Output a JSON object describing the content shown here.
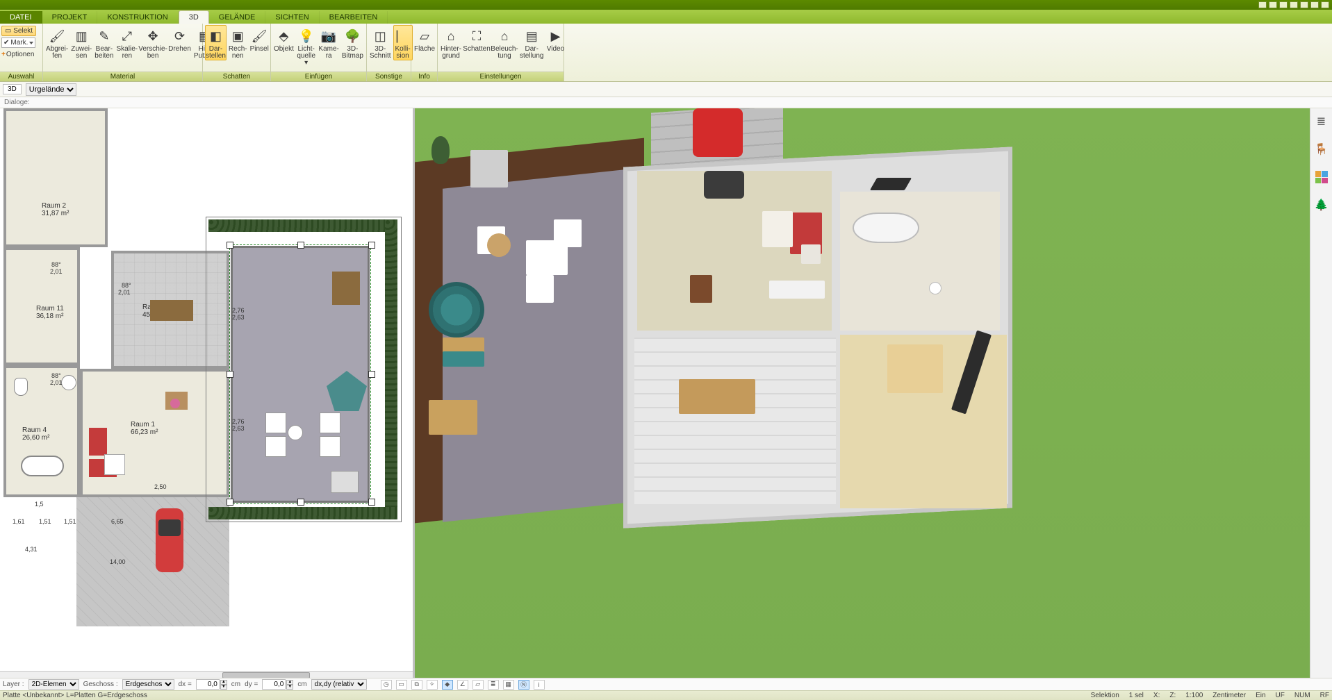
{
  "window_icons": 7,
  "menu": {
    "tabs": [
      "DATEI",
      "PROJEKT",
      "KONSTRUKTION",
      "3D",
      "GELÄNDE",
      "SICHTEN",
      "BEARBEITEN"
    ],
    "active": "3D"
  },
  "ribbon": {
    "groups": {
      "auswahl": {
        "title": "Auswahl",
        "selekt": "Selekt",
        "mark": "Mark.",
        "optionen": "Optionen"
      },
      "material": {
        "title": "Material",
        "buttons": [
          {
            "id": "abgreifen",
            "label": "Abgrei-\nfen",
            "glyph": "🖌"
          },
          {
            "id": "zuweisen",
            "label": "Zuwei-\nsen",
            "glyph": "▥"
          },
          {
            "id": "bearbeiten",
            "label": "Bear-\nbeiten",
            "glyph": "✎"
          },
          {
            "id": "skalieren",
            "label": "Skalie-\nren",
            "glyph": "⤢"
          },
          {
            "id": "verschieben",
            "label": "Verschie-\nben",
            "glyph": "✥"
          },
          {
            "id": "drehen",
            "label": "Drehen",
            "glyph": "⟳"
          },
          {
            "id": "hinputzen",
            "label": "Hin.\nPutzen",
            "glyph": "▦"
          }
        ]
      },
      "schatten": {
        "title": "Schatten",
        "buttons": [
          {
            "id": "darstellen",
            "label": "Dar-\nstellen",
            "glyph": "◧",
            "active": true
          },
          {
            "id": "rechnen",
            "label": "Rech-\nnen",
            "glyph": "▣"
          },
          {
            "id": "pinsel",
            "label": "Pinsel",
            "glyph": "🖌"
          }
        ]
      },
      "einfuegen": {
        "title": "Einfügen",
        "buttons": [
          {
            "id": "objekt",
            "label": "Objekt",
            "glyph": "⬘"
          },
          {
            "id": "lichtquelle",
            "label": "Licht-\nquelle ▾",
            "glyph": "💡"
          },
          {
            "id": "kamera",
            "label": "Kame-\nra",
            "glyph": "📷"
          },
          {
            "id": "3dbitmap",
            "label": "3D-\nBitmap",
            "glyph": "🌳"
          }
        ]
      },
      "sonstige": {
        "title": "Sonstige",
        "buttons": [
          {
            "id": "3dschnitt",
            "label": "3D-\nSchnitt",
            "glyph": "◫"
          },
          {
            "id": "kollision",
            "label": "Kolli-\nsion",
            "glyph": "⎸",
            "active": true
          }
        ]
      },
      "info": {
        "title": "Info",
        "buttons": [
          {
            "id": "flaeche",
            "label": "Fläche",
            "glyph": "▱"
          }
        ]
      },
      "einstellungen": {
        "title": "Einstellungen",
        "buttons": [
          {
            "id": "hintergrund",
            "label": "Hinter-\ngrund",
            "glyph": "⌂"
          },
          {
            "id": "schatten2",
            "label": "Schatten",
            "glyph": "⛶"
          },
          {
            "id": "beleuchtung",
            "label": "Beleuch-\ntung",
            "glyph": "⌂"
          },
          {
            "id": "darstellung",
            "label": "Dar-\nstellung",
            "glyph": "▤"
          },
          {
            "id": "video",
            "label": "Video",
            "glyph": "▶"
          }
        ]
      }
    }
  },
  "subbar": {
    "view_tag": "3D",
    "dropdown": "Urgelände"
  },
  "dialoge_label": "Dialoge:",
  "plan": {
    "rooms": [
      {
        "id": "raum2",
        "name": "Raum 2",
        "area": "31,87 m²"
      },
      {
        "id": "raum11",
        "name": "Raum 11",
        "area": "36,18 m²"
      },
      {
        "id": "raum4",
        "name": "Raum 4",
        "area": "26,60 m²"
      },
      {
        "id": "raum3",
        "name": "Raum 3",
        "area": "45,42 m²"
      },
      {
        "id": "raum1",
        "name": "Raum 1",
        "area": "66,23 m²"
      }
    ],
    "dims": {
      "d201a": "2,01",
      "d88a": "88°",
      "d201b": "2,01",
      "d88b": "88°",
      "d276a": "2,76",
      "d263a": "2,63",
      "d276b": "2,76",
      "d263b": "2,63",
      "d250": "2,50",
      "d15": "1,5",
      "d161": "1,61",
      "d151a": "1,51",
      "d151b": "1,51",
      "d665": "6,65",
      "d431": "4,31",
      "d1400": "14,00",
      "d88c": "88°",
      "d201c": "2,01"
    }
  },
  "rail": {
    "layers": "≣",
    "chair": "🪑",
    "colors": "",
    "tree": "🌲"
  },
  "bottom": {
    "layer_label": "Layer :",
    "layer_value": "2D-Elemen",
    "geschoss_label": "Geschoss :",
    "geschoss_value": "Erdgeschos",
    "dx_label": "dx =",
    "dx_val": "0,0",
    "dx_unit": "cm",
    "dy_label": "dy =",
    "dy_val": "0,0",
    "dy_unit": "cm",
    "mode": "dx,dy (relativ ka"
  },
  "status": {
    "left": "Platte <Unbekannt> L=Platten G=Erdgeschoss",
    "selektion": "Selektion",
    "x": "X:",
    "z": "Z:",
    "scale": "1:100",
    "unit": "Zentimeter",
    "ein": "Ein",
    "uf": "UF",
    "num": "NUM",
    "rf": "RF",
    "sel": "1 sel"
  }
}
